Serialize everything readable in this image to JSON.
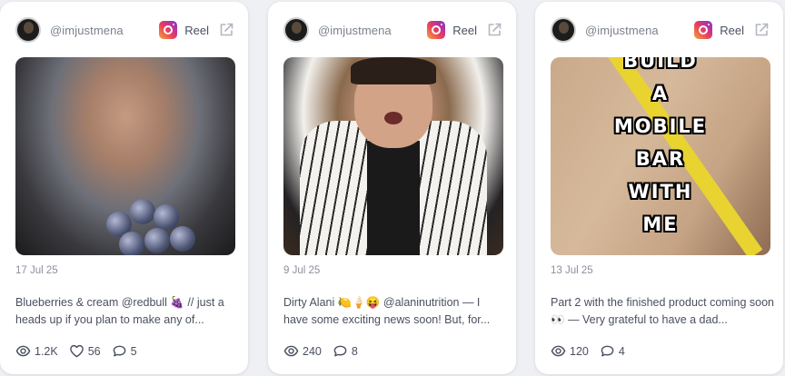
{
  "cards": [
    {
      "handle": "@imjustmena",
      "type_label": "Reel",
      "date": "17 Jul 25",
      "caption": "Blueberries & cream @redbull 🍇 // just a heads up if you plan to make any of...",
      "views": "1.2K",
      "likes": "56",
      "comments": "5"
    },
    {
      "handle": "@imjustmena",
      "type_label": "Reel",
      "date": "9 Jul 25",
      "caption": "Dirty Alani 🍋🍦😝 @alaninutrition — I have some exciting news soon! But, for...",
      "views": "240",
      "comments": "8"
    },
    {
      "handle": "@imjustmena",
      "type_label": "Reel",
      "date": "13 Jul 25",
      "caption": "Part 2 with the finished product coming soon 👀 — Very grateful to have a dad...",
      "views": "120",
      "comments": "4",
      "overlay_lines": [
        "BUILD",
        "A",
        "MOBILE",
        "BAR",
        "WITH",
        "ME"
      ]
    }
  ]
}
